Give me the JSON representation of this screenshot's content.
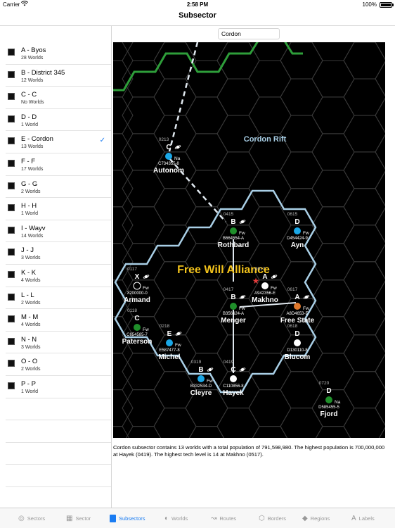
{
  "status_bar": {
    "carrier": "Carrier",
    "time": "2:58 PM",
    "battery": "100%"
  },
  "nav": {
    "title": "Subsector"
  },
  "search": {
    "value": "Cordon"
  },
  "subsectors": [
    {
      "label": "A - Byos",
      "count": "28 Worlds",
      "selected": false
    },
    {
      "label": "B - District 345",
      "count": "12 Worlds",
      "selected": false
    },
    {
      "label": "C - C",
      "count": "No Worlds",
      "selected": false
    },
    {
      "label": "D - D",
      "count": "1 World",
      "selected": false
    },
    {
      "label": "E - Cordon",
      "count": "13 Worlds",
      "selected": true
    },
    {
      "label": "F - F",
      "count": "17 Worlds",
      "selected": false
    },
    {
      "label": "G - G",
      "count": "2 Worlds",
      "selected": false
    },
    {
      "label": "H - H",
      "count": "1 World",
      "selected": false
    },
    {
      "label": "I - Wayv",
      "count": "14 Worlds",
      "selected": false
    },
    {
      "label": "J - J",
      "count": "3 Worlds",
      "selected": false
    },
    {
      "label": "K - K",
      "count": "4 Worlds",
      "selected": false
    },
    {
      "label": "L - L",
      "count": "2 Worlds",
      "selected": false
    },
    {
      "label": "M - M",
      "count": "4 Worlds",
      "selected": false
    },
    {
      "label": "N - N",
      "count": "3 Worlds",
      "selected": false
    },
    {
      "label": "O - O",
      "count": "2 Worlds",
      "selected": false
    },
    {
      "label": "P - P",
      "count": "1 World",
      "selected": false
    }
  ],
  "map": {
    "region_label": "Cordon Rift",
    "polity_label": "Free Will Alliance",
    "colors": {
      "background": "#000000",
      "grid": "#3a3a3a",
      "border_alliance": "#a9cfe6",
      "border_green": "#2e9e3a",
      "route": "#dfe7ee",
      "polity": "#f2c21b",
      "rift_label": "#a9cfe6",
      "water": "#1aa7e6",
      "garden": "#1f8f2a",
      "rock": "#ffffff",
      "desert": "#e0782c",
      "capital_star": "#e23b3b"
    },
    "worlds": [
      {
        "name": "Autonom",
        "hex": "0213",
        "starport": "C",
        "uwp": "C734355-8",
        "bases": "Na",
        "planet": "water",
        "gas_giant": true
      },
      {
        "name": "Rothbard",
        "hex": "0415",
        "starport": "B",
        "uwp": "B664554-A",
        "bases": "Fw",
        "planet": "garden",
        "gas_giant": true
      },
      {
        "name": "Ayn",
        "hex": "0615",
        "starport": "D",
        "uwp": "D454424-9",
        "bases": "Fw",
        "planet": "water",
        "gas_giant": false
      },
      {
        "name": "Armand",
        "hex": "0117",
        "starport": "X",
        "uwp": "X200000-0",
        "bases": "Fw",
        "planet": "hollow",
        "gas_giant": true
      },
      {
        "name": "Makhno",
        "hex": "0517",
        "starport": "A",
        "uwp": "A942356-E",
        "bases": "Fw",
        "planet": "rock",
        "gas_giant": true
      },
      {
        "name": "Menger",
        "hex": "0417",
        "starport": "B",
        "uwp": "B356624-A",
        "bases": "Fw",
        "planet": "garden",
        "gas_giant": true
      },
      {
        "name": "Free State",
        "hex": "0617",
        "starport": "A",
        "uwp": "A8D4653-E",
        "bases": "Fw",
        "planet": "desert",
        "gas_giant": true
      },
      {
        "name": "Paterson",
        "hex": "0118",
        "starport": "C",
        "uwp": "C654585-7",
        "bases": "Fw",
        "planet": "garden",
        "gas_giant": false
      },
      {
        "name": "Michel",
        "hex": "0218",
        "starport": "E",
        "uwp": "E587477-8",
        "bases": "Fw",
        "planet": "water",
        "gas_giant": true
      },
      {
        "name": "Blucom",
        "hex": "0618",
        "starport": "D",
        "uwp": "D130110-8",
        "bases": "",
        "planet": "rock",
        "gas_giant": false
      },
      {
        "name": "Cleyre",
        "hex": "0319",
        "starport": "B",
        "uwp": "B332534-D",
        "bases": "Fw",
        "planet": "water",
        "gas_giant": true
      },
      {
        "name": "Hayek",
        "hex": "0419",
        "starport": "C",
        "uwp": "C110856-8",
        "bases": "",
        "planet": "rock",
        "gas_giant": true
      },
      {
        "name": "Fjord",
        "hex": "0720",
        "starport": "D",
        "uwp": "D585455-5",
        "bases": "Na",
        "planet": "garden",
        "gas_giant": false
      }
    ]
  },
  "summary": "Cordon subsector contains 13 worlds with a total population of 791,598,980. The highest population is 700,000,000 at Hayek (0419). The highest tech level is 14 at Makhno (0517).",
  "tabs": [
    {
      "label": "Sectors",
      "icon": "sectors-icon",
      "glyph": "◎",
      "active": false
    },
    {
      "label": "Sector",
      "icon": "sector-icon",
      "glyph": "▦",
      "active": false
    },
    {
      "label": "Subsectors",
      "icon": "subsectors-icon",
      "glyph": "",
      "active": true
    },
    {
      "label": "Worlds",
      "icon": "worlds-icon",
      "glyph": "◐",
      "active": false
    },
    {
      "label": "Routes",
      "icon": "routes-icon",
      "glyph": "↝",
      "active": false
    },
    {
      "label": "Borders",
      "icon": "borders-icon",
      "glyph": "⬡",
      "active": false
    },
    {
      "label": "Regions",
      "icon": "regions-icon",
      "glyph": "◆",
      "active": false
    },
    {
      "label": "Labels",
      "icon": "labels-icon",
      "glyph": "A",
      "active": false
    }
  ]
}
